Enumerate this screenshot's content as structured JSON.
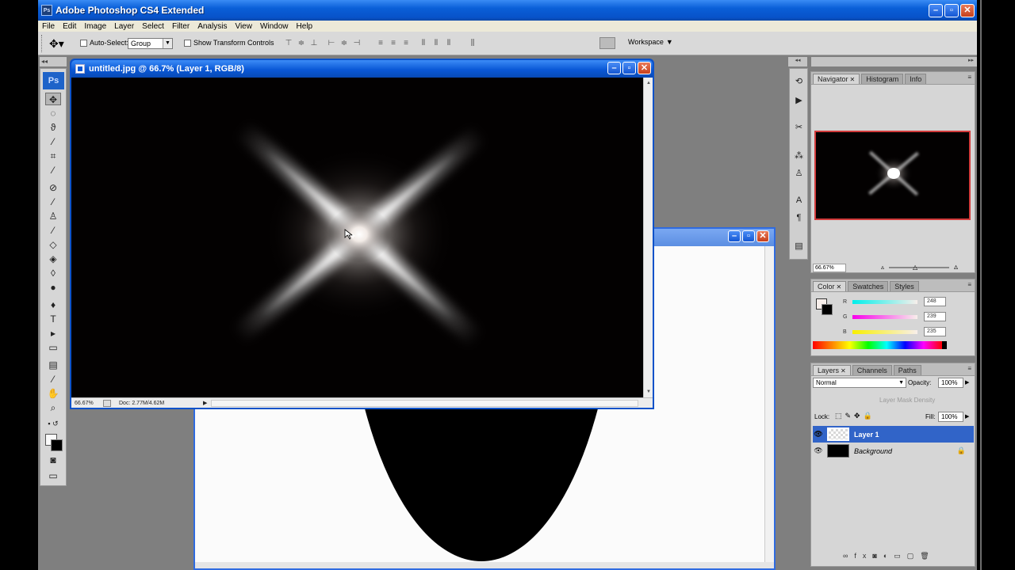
{
  "app": {
    "title": "Adobe Photoshop CS4 Extended",
    "logo": "Ps",
    "window_buttons": [
      "minimize-icon",
      "maximize-icon",
      "close-icon"
    ]
  },
  "menu": [
    "File",
    "Edit",
    "Image",
    "Layer",
    "Select",
    "Filter",
    "Analysis",
    "View",
    "Window",
    "Help"
  ],
  "options": {
    "auto_select_label": "Auto-Select:",
    "auto_select_value": "Group",
    "transform_label": "Show Transform Controls",
    "workspace_label": "Workspace"
  },
  "tools": {
    "badge": "Ps",
    "items": [
      "move-tool",
      "marquee-tool",
      "lasso-tool",
      "magic-wand-tool",
      "crop-tool",
      "eyedropper-tool",
      "healing-brush-tool",
      "brush-tool",
      "clone-stamp-tool",
      "history-brush-tool",
      "eraser-tool",
      "paint-bucket-tool",
      "blur-tool",
      "dodge-tool",
      "pen-tool",
      "type-tool",
      "path-selection-tool",
      "rectangle-tool",
      "notes-tool",
      "eyedropper-3d-tool",
      "hand-tool",
      "zoom-tool"
    ]
  },
  "document": {
    "title": "untitled.jpg @ 66.7% (Layer 1, RGB/8)",
    "zoom": "66.67%",
    "doc_info": "Doc: 2.77M/4.62M"
  },
  "navigator_panel": {
    "tabs": [
      "Navigator",
      "Histogram",
      "Info"
    ],
    "zoom": "66.67%"
  },
  "color_panel": {
    "tabs": [
      "Color",
      "Swatches",
      "Styles"
    ],
    "channels": [
      {
        "label": "R",
        "value": "248"
      },
      {
        "label": "G",
        "value": "239"
      },
      {
        "label": "B",
        "value": "235"
      }
    ]
  },
  "layers_panel": {
    "tabs": [
      "Layers",
      "Channels",
      "Paths"
    ],
    "blend_mode": "Normal",
    "opacity_label": "Opacity:",
    "opacity": "100%",
    "mask_density": "Layer Mask Density",
    "lock_label": "Lock:",
    "fill_label": "Fill:",
    "fill": "100%",
    "layers": [
      {
        "name": "Layer 1",
        "selected": true
      },
      {
        "name": "Background",
        "selected": false,
        "locked": true
      }
    ]
  },
  "colors": {
    "title_bar": "#0a58d6",
    "selected_layer": "#3164c8",
    "canvas": "#030101",
    "nav_frame": "#d23c3c"
  }
}
